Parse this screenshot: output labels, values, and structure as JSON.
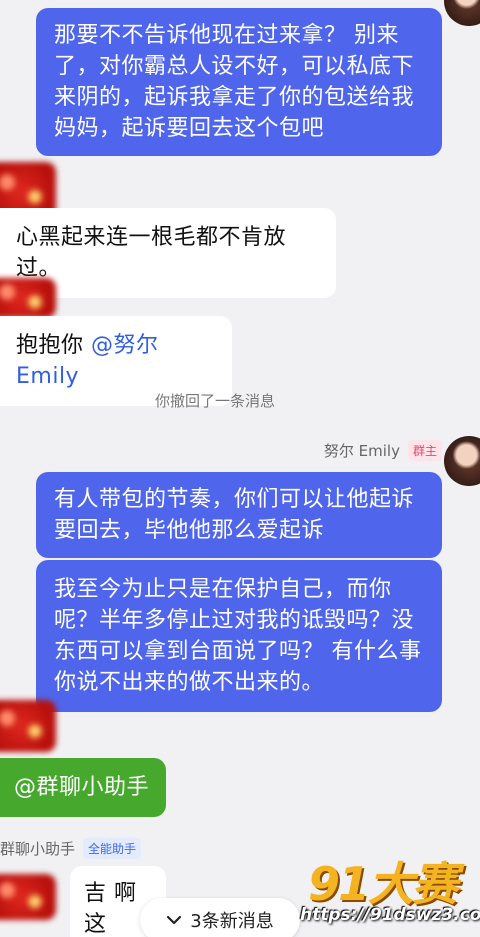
{
  "messages": {
    "m1_lines": [
      "那要不不告诉他现在过来拿？ 别来",
      "了，对你霸总人设不好，可以私底下",
      "来阴的，起诉我拿走了你的包送给我",
      "妈妈，起诉要回去这个包吧"
    ],
    "m2": "心黑起来连一根毛都不肯放过。",
    "m3_prefix": "抱抱你 ",
    "m3_mention": "@努尔 Emily",
    "system_note": "你撤回了一条消息",
    "sender_name": "努尔 Emily",
    "sender_tag": "群主",
    "m4_lines": [
      "有人带包的节奏，你们可以让他起诉",
      "要回去，毕他他那么爱起诉"
    ],
    "m5_lines": [
      "我至今为止只是在保护自己，而你",
      "呢？半年多停止过对我的诋毁吗？没",
      "东西可以拿到台面说了吗？ 有什么事",
      "你说不出来的做不出来的。"
    ],
    "m6": "@群聊小助手",
    "helper_name": "群聊小助手",
    "helper_tag": "全能助手",
    "m7": "吉 啊这"
  },
  "new_messages_pill": {
    "icon": "chevron-down-icon",
    "label": "3条新消息"
  },
  "watermark": {
    "logo": "91大赛",
    "url": "https://91dswz3.com"
  },
  "colors": {
    "blue_bubble": "#4f66ec",
    "green_bubble": "#46a92e",
    "mention": "#2f5fe0",
    "background": "#f1f1f3"
  }
}
